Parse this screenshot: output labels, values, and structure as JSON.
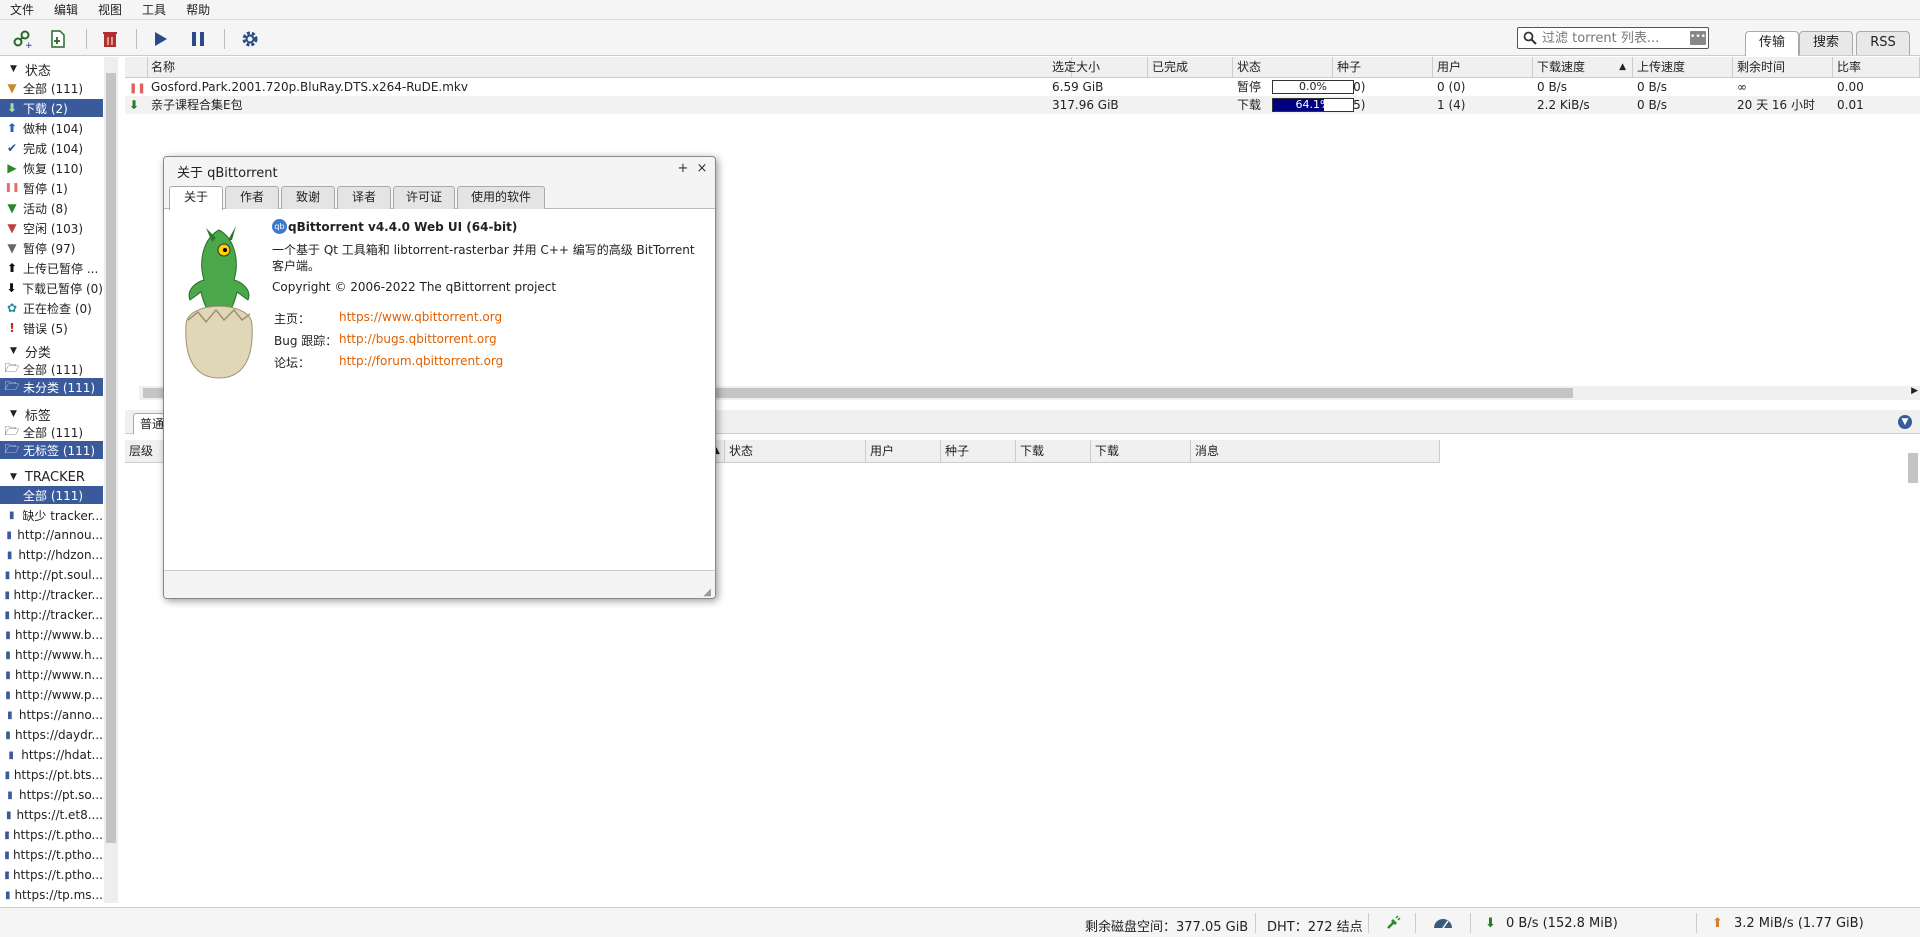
{
  "menu": [
    "文件",
    "编辑",
    "视图",
    "工具",
    "帮助"
  ],
  "search": {
    "placeholder": "过滤 torrent 列表..."
  },
  "main_tabs": [
    "传输",
    "搜索",
    "RSS"
  ],
  "sidebar": {
    "status_header": "状态",
    "status_items": [
      {
        "label": "全部 (111)",
        "icon": "filter-icon",
        "color": "#c98a2e"
      },
      {
        "label": "下载 (2)",
        "icon": "download-arrow-icon",
        "color": "#2a8a2a"
      },
      {
        "label": "做种 (104)",
        "icon": "upload-arrow-icon",
        "color": "#2a5fcf"
      },
      {
        "label": "完成 (104)",
        "icon": "checkmark-icon",
        "color": "#2a4f9f"
      },
      {
        "label": "恢复 (110)",
        "icon": "play-icon",
        "color": "#2a8a2a"
      },
      {
        "label": "暂停 (1)",
        "icon": "pause-icon",
        "color": "#e07070"
      },
      {
        "label": "活动 (8)",
        "icon": "filter-icon",
        "color": "#2a8a2a"
      },
      {
        "label": "空闲 (103)",
        "icon": "filter-icon",
        "color": "#c04040"
      },
      {
        "label": "暂停 (97)",
        "icon": "filter-icon",
        "color": "#666666"
      },
      {
        "label": "上传已暂停 ...",
        "icon": "upload-arrow-icon",
        "color": "#111111"
      },
      {
        "label": "下载已暂停 (0)",
        "icon": "download-arrow-icon",
        "color": "#111111"
      },
      {
        "label": "正在检查 (0)",
        "icon": "gear-icon",
        "color": "#2a8aa0"
      },
      {
        "label": "错误 (5)",
        "icon": "error-icon",
        "color": "#d02020"
      }
    ],
    "category_header": "分类",
    "category_items": [
      {
        "label": "全部 (111)",
        "icon": "folder-icon"
      },
      {
        "label": "未分类 (111)",
        "icon": "folder-icon"
      }
    ],
    "tag_header": "标签",
    "tag_items": [
      {
        "label": "全部 (111)",
        "icon": "folder-icon"
      },
      {
        "label": "无标签 (111)",
        "icon": "folder-icon"
      }
    ],
    "tracker_header": "TRACKER",
    "tracker_items": [
      "全部 (111)",
      "缺少 tracker...",
      "http://annou...",
      "http://hdzon...",
      "http://pt.soul...",
      "http://tracker...",
      "http://tracker...",
      "http://www.b...",
      "http://www.h...",
      "http://www.n...",
      "http://www.p...",
      "https://anno...",
      "https://daydr...",
      "https://hdat...",
      "https://pt.bts...",
      "https://pt.so...",
      "https://t.et8....",
      "https://t.ptho...",
      "https://t.ptho...",
      "https://t.ptho...",
      "https://tp.ms..."
    ]
  },
  "torrent_table": {
    "columns": [
      "名称",
      "选定大小",
      "已完成",
      "状态",
      "种子",
      "用户",
      "下载速度",
      "上传速度",
      "剩余时间",
      "比率"
    ],
    "rows": [
      {
        "icon": "pause-icon",
        "name": "Gosford.Park.2001.720p.BluRay.DTS.x264-RuDE.mkv",
        "size": "6.59 GiB",
        "progress": 0.0,
        "progress_label": "0.0%",
        "status": "暂停",
        "seeds": "0 (0)",
        "peers": "0 (0)",
        "dl": "0 B/s",
        "ul": "0 B/s",
        "eta": "∞",
        "ratio": "0.00"
      },
      {
        "icon": "download-arrow-icon",
        "name": "亲子课程合集E包",
        "size": "317.96 GiB",
        "progress": 0.641,
        "progress_label": "64.1%",
        "status": "下载",
        "seeds": "4 (5)",
        "peers": "1 (4)",
        "dl": "2.2 KiB/s",
        "ul": "0 B/s",
        "eta": "20 天 16 小时",
        "ratio": "0.01"
      }
    ]
  },
  "lower": {
    "tab": "普通",
    "columns": [
      "层级",
      "状态",
      "用户",
      "种子",
      "下载",
      "下载",
      "消息"
    ]
  },
  "status_bar": {
    "free_space": "剩余磁盘空间：377.05 GiB",
    "dht": "DHT：272 结点",
    "download": "0 B/s (152.8 MiB)",
    "upload": "3.2 MiB/s (1.77 GiB)"
  },
  "about_dialog": {
    "title": "关于 qBittorrent",
    "tabs": [
      "关于",
      "作者",
      "致谢",
      "译者",
      "许可证",
      "使用的软件"
    ],
    "logo_text": "qb",
    "heading": "qBittorrent v4.4.0 Web UI (64-bit)",
    "description": "一个基于 Qt 工具箱和 libtorrent-rasterbar 并用 C++ 编写的高级 BitTorrent 客户端。",
    "copyright": "Copyright © 2006-2022 The qBittorrent project",
    "links": [
      {
        "label": "主页：",
        "url": "https://www.qbittorrent.org"
      },
      {
        "label": "Bug 跟踪：",
        "url": "http://bugs.qbittorrent.org"
      },
      {
        "label": "论坛：",
        "url": "http://forum.qbittorrent.org"
      }
    ]
  }
}
